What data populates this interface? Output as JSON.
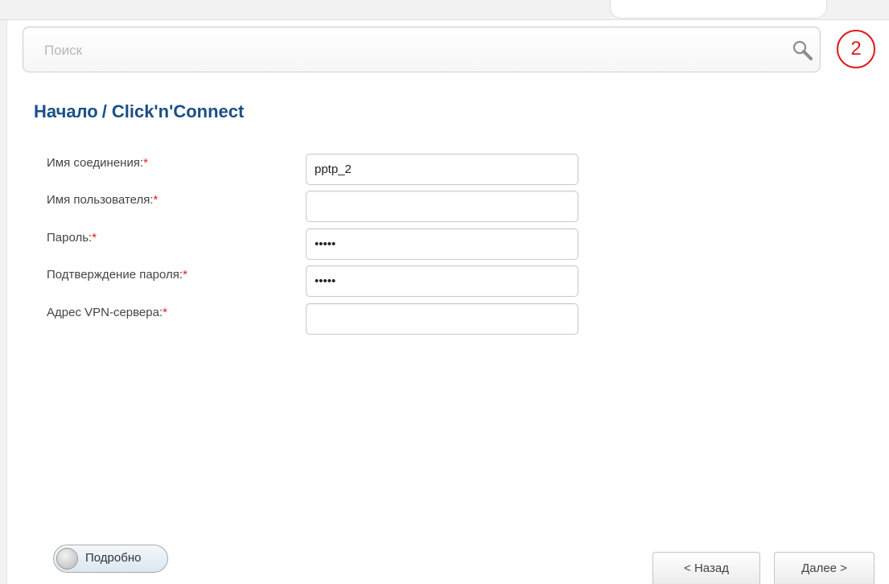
{
  "search": {
    "placeholder": "Поиск",
    "value": ""
  },
  "step_indicator": "2",
  "breadcrumb": {
    "home": "Начало",
    "separator": "/",
    "current": "Click'n'Connect"
  },
  "form": {
    "required_mark": "*",
    "fields": [
      {
        "label": "Имя соединения:",
        "value": "pptp_2",
        "type": "text"
      },
      {
        "label": "Имя пользователя:",
        "value": "",
        "type": "text"
      },
      {
        "label": "Пароль:",
        "value": "•••••",
        "type": "password"
      },
      {
        "label": "Подтверждение пароля:",
        "value": "•••••",
        "type": "password"
      },
      {
        "label": "Адрес VPN-сервера:",
        "value": "",
        "type": "text"
      }
    ]
  },
  "advanced_toggle": {
    "label": "Подробно",
    "state": "off"
  },
  "buttons": {
    "back": "< Назад",
    "next": "Далее >"
  },
  "colors": {
    "title": "#1b4f86",
    "required": "#e01b1b",
    "step_indicator": "#e01b1b"
  },
  "icons": {
    "search": "search-icon"
  }
}
